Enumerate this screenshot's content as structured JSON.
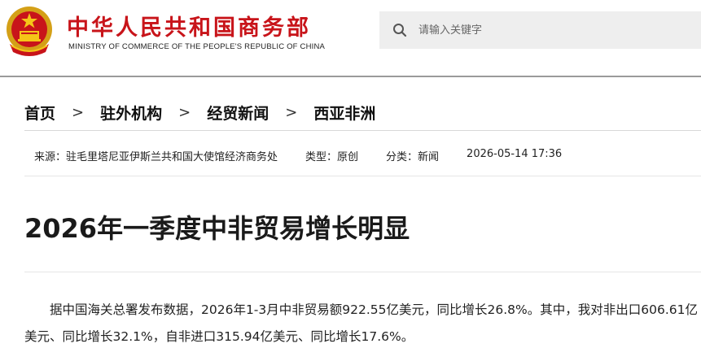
{
  "header": {
    "site_name": "中华人民共和国商务部",
    "site_name_en": "MINISTRY OF COMMERCE OF THE PEOPLE'S REPUBLIC OF CHINA",
    "emblem_icon": "national-emblem-icon",
    "brand_color": "#c8141a"
  },
  "search": {
    "placeholder": "请输入关键字",
    "icon": "search-icon"
  },
  "breadcrumb": {
    "items": [
      "首页",
      "驻外机构",
      "经贸新闻",
      "西亚非洲"
    ],
    "separator": ">"
  },
  "meta": {
    "source": "来源：驻毛里塔尼亚伊斯兰共和国大使馆经济商务处",
    "type": "类型：原创",
    "category": "分类：新闻",
    "datetime": "2026-05-14 17:36"
  },
  "article": {
    "title": "2026年一季度中非贸易增长明显",
    "paragraphs": [
      "据中国海关总署发布数据，2026年1-3月中非贸易额922.55亿美元，同比增长26.8%。其中，我对非出口606.61亿美元、同比增长32.1%，自非进口315.94亿美元、同比增长17.6%。"
    ]
  }
}
